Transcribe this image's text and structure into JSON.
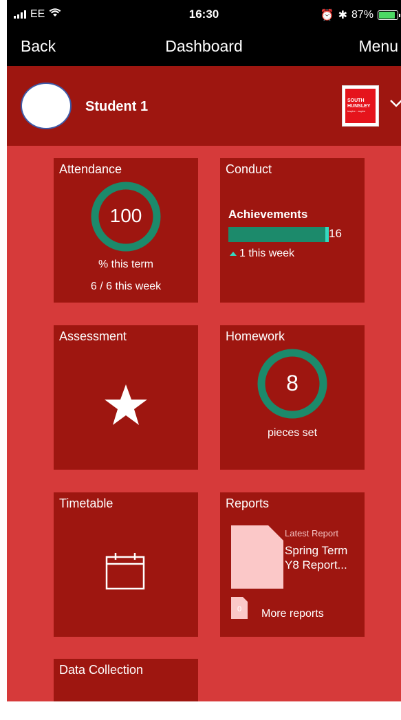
{
  "status": {
    "carrier": "EE",
    "time": "16:30",
    "battery": "87%",
    "battery_level": 0.87
  },
  "nav": {
    "back": "Back",
    "title": "Dashboard",
    "menu": "Menu"
  },
  "header": {
    "student": "Student 1",
    "logo_text": "SOUTH HUNSLEY",
    "logo_tagline": "inspire · aspire"
  },
  "tiles": {
    "attendance": {
      "title": "Attendance",
      "value": "100",
      "caption": "% this term",
      "week": "6 / 6 this week",
      "ring_fraction": 1.0
    },
    "conduct": {
      "title": "Conduct",
      "label": "Achievements",
      "value": "16",
      "week": "1 this week"
    },
    "assessment": {
      "title": "Assessment"
    },
    "homework": {
      "title": "Homework",
      "value": "8",
      "caption": "pieces set",
      "ring_fraction": 1.0
    },
    "timetable": {
      "title": "Timetable"
    },
    "reports": {
      "title": "Reports",
      "latest_label": "Latest Report",
      "latest_name": "Spring Term Y8 Report...",
      "count": "0",
      "more": "More reports"
    },
    "data_collection": {
      "title": "Data Collection"
    }
  },
  "colors": {
    "accent": "#1c8a6b",
    "tile": "#9e1610",
    "background": "#d63a3a"
  }
}
